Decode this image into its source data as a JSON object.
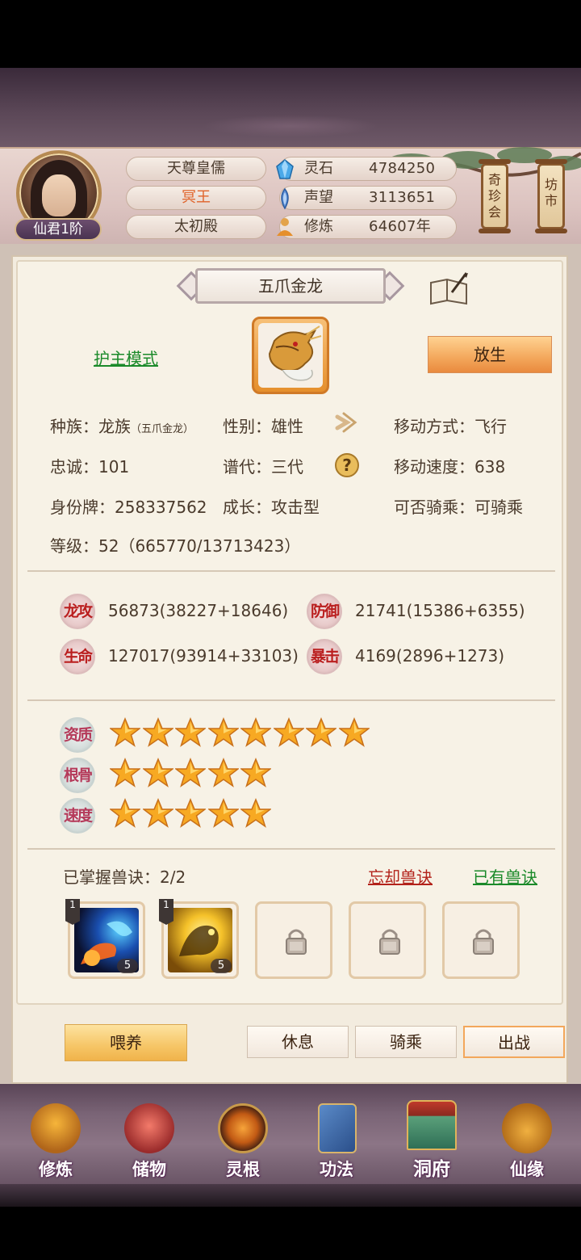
{
  "header": {
    "rank_badge": "仙君1阶",
    "titles": [
      "天尊皇儒",
      "冥王",
      "太初殿"
    ],
    "titles_colors": [
      "#4a3a2c",
      "#e0632a",
      "#4a3a2c"
    ],
    "resources": [
      {
        "icon": "spirit-stone-icon",
        "label": "灵石",
        "value": "4784250"
      },
      {
        "icon": "reputation-icon",
        "label": "声望",
        "value": "3113651"
      },
      {
        "icon": "cultivation-icon",
        "label": "修炼",
        "value": "64607年"
      }
    ],
    "side_buttons": [
      {
        "label": "奇珍会"
      },
      {
        "label": "坊市"
      }
    ]
  },
  "pet": {
    "name": "五爪金龙",
    "guard_mode": "护主模式",
    "release_button": "放生",
    "info": {
      "race_label": "种族：龙族",
      "race_sub": "（五爪金龙）",
      "gender": "性别：雄性",
      "move_mode": "移动方式：飞行",
      "loyalty": "忠诚：101",
      "generation": "谱代：三代",
      "move_speed": "移动速度：638",
      "id_tag": "身份牌：258337562",
      "growth": "成长：攻击型",
      "rideable": "可否骑乘：可骑乘",
      "level": "等级：52（665770/13713423）"
    },
    "stats": [
      {
        "badge": "龙攻",
        "value": "56873(38227+18646)"
      },
      {
        "badge": "防御",
        "value": "21741(15386+6355)"
      },
      {
        "badge": "生命",
        "value": "127017(93914+33103)"
      },
      {
        "badge": "暴击",
        "value": "4169(2896+1273)"
      }
    ],
    "qualities": [
      {
        "badge": "资质",
        "stars": 8
      },
      {
        "badge": "根骨",
        "stars": 5
      },
      {
        "badge": "速度",
        "stars": 5
      }
    ],
    "skills_mastered": "已掌握兽诀：2/2",
    "forget_skill": "忘却兽诀",
    "owned_skills": "已有兽诀",
    "skill_slots": [
      {
        "state": "filled",
        "level": "1",
        "count": "5",
        "theme": "blue-fire"
      },
      {
        "state": "filled",
        "level": "1",
        "count": "5",
        "theme": "gold"
      },
      {
        "state": "locked"
      },
      {
        "state": "locked"
      },
      {
        "state": "locked"
      }
    ],
    "actions": {
      "feed": "喂养",
      "rest": "休息",
      "ride": "骑乘",
      "battle": "出战"
    }
  },
  "nav": [
    {
      "label": "修炼",
      "icon": "cultivate-icon"
    },
    {
      "label": "储物",
      "icon": "storage-bag-icon"
    },
    {
      "label": "灵根",
      "icon": "spirit-root-icon"
    },
    {
      "label": "功法",
      "icon": "technique-book-icon"
    },
    {
      "label": "洞府",
      "icon": "cave-house-icon"
    },
    {
      "label": "仙缘",
      "icon": "immortal-fate-icon"
    }
  ]
}
